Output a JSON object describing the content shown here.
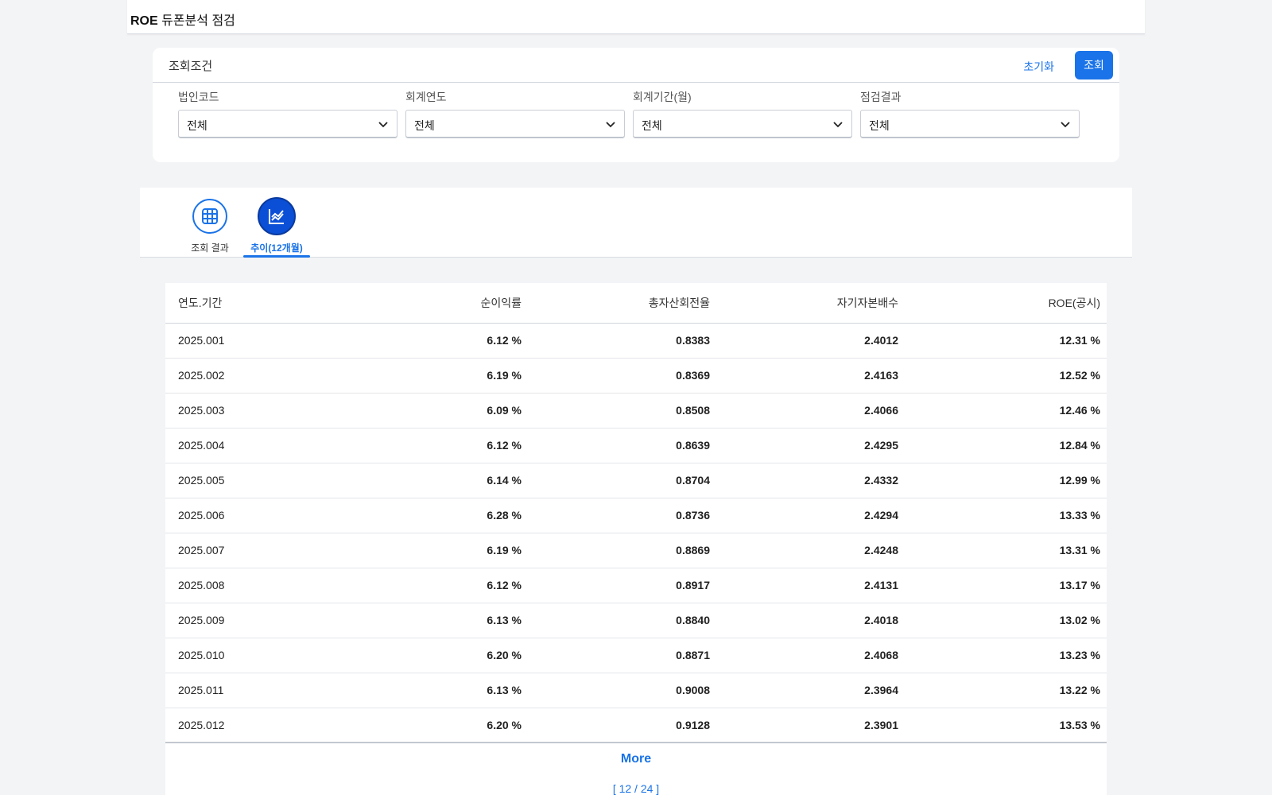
{
  "header": {
    "title_bold": "ROE",
    "title_rest": " 듀폰분석 점검"
  },
  "search": {
    "label": "조회조건",
    "reset_label": "초기화",
    "search_label": "조회",
    "fields": [
      {
        "label": "법인코드",
        "value": "전체"
      },
      {
        "label": "회계연도",
        "value": "전체"
      },
      {
        "label": "회계기간(월)",
        "value": "전체"
      },
      {
        "label": "점검결과",
        "value": "전체"
      }
    ]
  },
  "tabs": [
    {
      "label": "조회 결과",
      "icon": "grid-icon",
      "active": false
    },
    {
      "label": "추이(12개월)",
      "icon": "chart-icon",
      "active": true
    }
  ],
  "table": {
    "headers": [
      "연도.기간",
      "순이익률",
      "총자산회전율",
      "자기자본배수",
      "ROE(공시)"
    ],
    "rows": [
      [
        "2025.001",
        "6.12 %",
        "0.8383",
        "2.4012",
        "12.31 %"
      ],
      [
        "2025.002",
        "6.19 %",
        "0.8369",
        "2.4163",
        "12.52 %"
      ],
      [
        "2025.003",
        "6.09 %",
        "0.8508",
        "2.4066",
        "12.46 %"
      ],
      [
        "2025.004",
        "6.12 %",
        "0.8639",
        "2.4295",
        "12.84 %"
      ],
      [
        "2025.005",
        "6.14 %",
        "0.8704",
        "2.4332",
        "12.99 %"
      ],
      [
        "2025.006",
        "6.28 %",
        "0.8736",
        "2.4294",
        "13.33 %"
      ],
      [
        "2025.007",
        "6.19 %",
        "0.8869",
        "2.4248",
        "13.31 %"
      ],
      [
        "2025.008",
        "6.12 %",
        "0.8917",
        "2.4131",
        "13.17 %"
      ],
      [
        "2025.009",
        "6.13 %",
        "0.8840",
        "2.4018",
        "13.02 %"
      ],
      [
        "2025.010",
        "6.20 %",
        "0.8871",
        "2.4068",
        "13.23 %"
      ],
      [
        "2025.011",
        "6.13 %",
        "0.9008",
        "2.3964",
        "13.22 %"
      ],
      [
        "2025.012",
        "6.20 %",
        "0.9128",
        "2.3901",
        "13.53 %"
      ]
    ]
  },
  "more_label": "More",
  "pager": "[ 12 / 24 ]",
  "colors": {
    "accent": "#1a73e8",
    "active_tab": "#0a4fd6"
  }
}
